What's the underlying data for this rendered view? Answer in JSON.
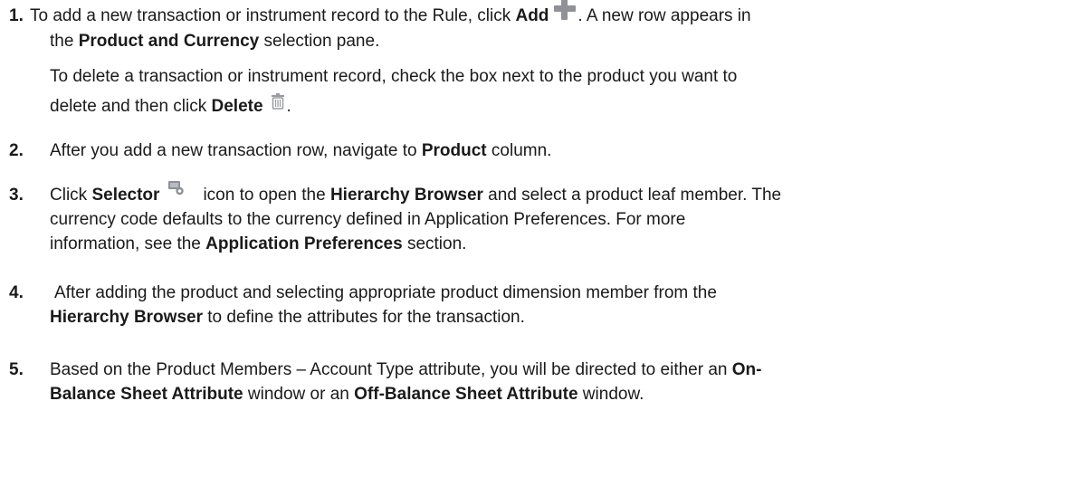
{
  "steps": [
    {
      "number": "1.",
      "line1": {
        "t1": "To add a new transaction or instrument record to the Rule, click ",
        "b1": "Add",
        "t2": ". A new row appears in"
      },
      "line2": {
        "t1": "the ",
        "b1": "Product and Currency",
        "t2": " selection pane."
      },
      "note_line1": "To delete a transaction or instrument record, check the box next to the product you want to",
      "note_line2": {
        "t1": "delete and then click ",
        "b1": "Delete",
        "t2": "."
      },
      "icons": [
        "plus-icon",
        "trash-icon"
      ]
    },
    {
      "number": "2.",
      "t1": "After you add a new transaction row, navigate to ",
      "b1": "Product",
      "t2": " column."
    },
    {
      "number": "3.",
      "line1": {
        "t1": "Click ",
        "b1": "Selector",
        "t2": "icon to open the ",
        "b2": "Hierarchy Browser",
        "t3": " and select a product leaf member. The"
      },
      "line2": "currency code defaults to the currency defined in Application Preferences. For more",
      "line3": {
        "t1": "information, see the ",
        "b1": "Application Preferences",
        "t2": " section."
      },
      "icons": [
        "selector-icon"
      ]
    },
    {
      "number": "4.",
      "line1": "After adding the product and selecting appropriate product dimension member from the",
      "line2": {
        "b1": "Hierarchy Browser",
        "t1": " to define the attributes for the transaction."
      }
    },
    {
      "number": "5.",
      "line1": {
        "t1": "Based on the Product Members – Account Type attribute, you will be directed to either an ",
        "b1": "On-"
      },
      "line2": {
        "b1": "Balance Sheet Attribute",
        "t1": " window or an ",
        "b2": "Off-Balance Sheet Attribute",
        "t2": " window."
      }
    }
  ]
}
